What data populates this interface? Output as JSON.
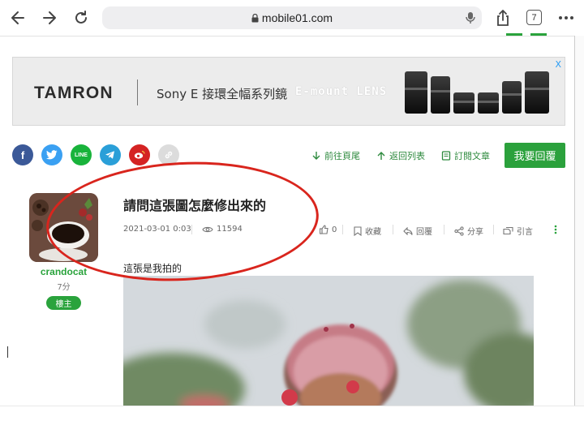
{
  "browser": {
    "url": "mobile01.com",
    "tab_count": "7"
  },
  "ad": {
    "brand": "TAMRON",
    "tagline": "Sony E 接環全幅系列鏡",
    "tagline_en": "E-mount LENS",
    "close_label": "X"
  },
  "social": {
    "line_label": "LINE",
    "facebook_label": "f"
  },
  "actions": {
    "goto_end": "前往頁尾",
    "back_to_list": "返回列表",
    "subscribe": "訂閱文章",
    "reply_button": "我要回覆"
  },
  "author": {
    "name": "crandocat",
    "score": "7分",
    "role_badge": "樓主"
  },
  "post": {
    "title": "請問這張圖怎麼修出來的",
    "date": "2021-03-01 0:03",
    "views": "11594",
    "likes": "0",
    "bookmark": "收藏",
    "reply": "回覆",
    "share": "分享",
    "quote": "引言",
    "body": "這張是我拍的"
  },
  "colors": {
    "accent_green": "#2ba13c",
    "annotation_red": "#d9251d",
    "facebook": "#3b5998",
    "twitter": "#3aa0f2",
    "line": "#18b33b",
    "telegram": "#2a9fd8",
    "weibo": "#d42323",
    "link_grey": "#d0d0d0"
  }
}
